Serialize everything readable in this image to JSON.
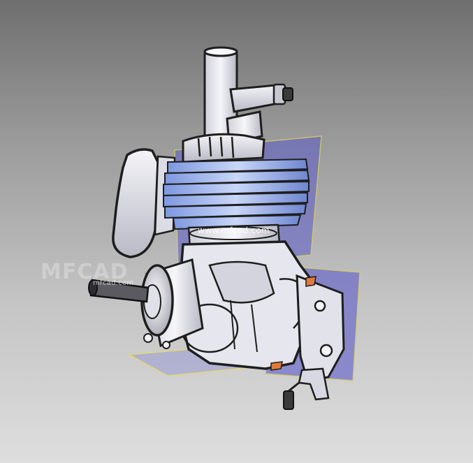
{
  "watermark": {
    "center_text": "www.mfcad.com",
    "left_logo_text": "MFCAD",
    "left_text": "mfcad.com"
  },
  "colors": {
    "background_top": "#6f6f6f",
    "background_bottom": "#dedede",
    "section_plane": "#5a5ac8",
    "fins": "#a0b8f0",
    "body": "#ececf2",
    "outline": "#1e1e1e",
    "highlight_orange": "#e07a3a"
  }
}
